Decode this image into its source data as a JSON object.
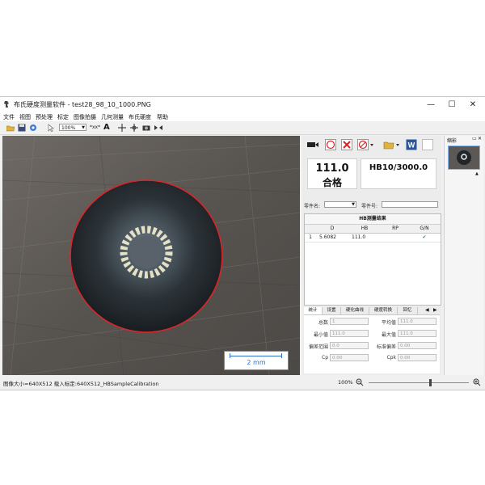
{
  "window": {
    "title": "布氏硬度测量软件 - test28_98_10_1000.PNG",
    "controls": {
      "minimize": "—",
      "maximize": "☐",
      "close": "✕"
    }
  },
  "menu": [
    "文件",
    "视图",
    "预处理",
    "标定",
    "图像拍摄",
    "几何测量",
    "布氏硬度",
    "帮助"
  ],
  "toolbar": {
    "zoom": "100%",
    "zoom_format": "*xx*",
    "text_tool": "A"
  },
  "image_view": {
    "scale_label": "2 mm"
  },
  "result": {
    "hb_value": "111.0",
    "verdict": "合格",
    "standard": "HB10/3000.0"
  },
  "fields": {
    "part_name_label": "零件名:",
    "part_no_label": "零件号:"
  },
  "table": {
    "title": "HB测量结果",
    "headers": [
      "",
      "D",
      "HB",
      "RP",
      "G/N"
    ],
    "rows": [
      {
        "index": "1",
        "d": "5.6082",
        "hb": "111.0",
        "rp": "",
        "gn": "✔"
      }
    ]
  },
  "tabs": [
    "统计",
    "设置",
    "硬化曲线",
    "硬度转换",
    "回忆"
  ],
  "stats": [
    {
      "label": "总数",
      "value": "1"
    },
    {
      "label": "平均值",
      "value": "111.0"
    },
    {
      "label": "最小值",
      "value": "111.0"
    },
    {
      "label": "最大值",
      "value": "111.0"
    },
    {
      "label": "偏差范围",
      "value": "0.0"
    },
    {
      "label": "标准偏差",
      "value": "0.00"
    },
    {
      "label": "Cp",
      "value": "0.00"
    },
    {
      "label": "Cpk",
      "value": "0.00"
    }
  ],
  "thumbnails_title": "缩影",
  "status": {
    "info": "图像大小=640X512  载入标定:640X512_HBSampleCalibration",
    "zoom": "100%",
    "slider_level": 0.62
  }
}
